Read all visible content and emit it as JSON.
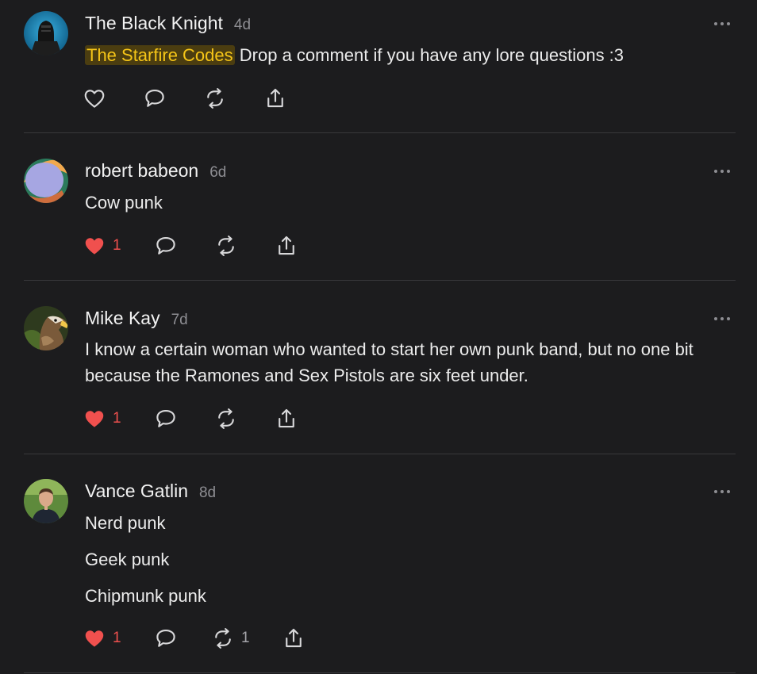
{
  "colors": {
    "background": "#1c1c1e",
    "text": "#ececec",
    "muted": "#8e8e93",
    "highlight_text": "#f5c518",
    "highlight_bg": "#4b3d10",
    "liked": "#f0504e",
    "divider": "#38383b"
  },
  "comments": [
    {
      "author": "The Black Knight",
      "time": "4d",
      "highlight": "The Starfire Codes",
      "text": "Drop a comment if you have any lore questions :3",
      "liked": false,
      "like_count": "",
      "repost_count": ""
    },
    {
      "author": "robert babeon",
      "time": "6d",
      "lines": [
        "Cow punk"
      ],
      "liked": true,
      "like_count": "1",
      "repost_count": ""
    },
    {
      "author": "Mike Kay",
      "time": "7d",
      "lines": [
        "I know a certain woman who wanted to start her own punk band, but no one bit because the Ramones and Sex Pistols are six feet under."
      ],
      "liked": true,
      "like_count": "1",
      "repost_count": ""
    },
    {
      "author": "Vance Gatlin",
      "time": "8d",
      "lines": [
        "Nerd punk",
        "Geek punk",
        "Chipmunk punk"
      ],
      "liked": true,
      "like_count": "1",
      "repost_count": "1"
    }
  ],
  "icons": {
    "more": "more-horizontal-icon",
    "like": "heart-icon",
    "reply": "speech-bubble-icon",
    "repost": "repost-icon",
    "share": "share-icon"
  }
}
